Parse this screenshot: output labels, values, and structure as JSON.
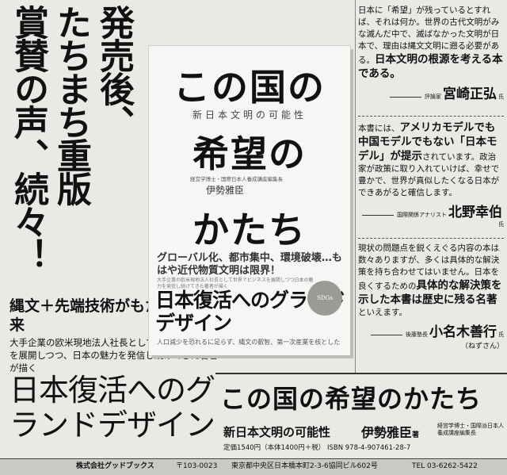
{
  "headline": {
    "line1": "発売後、",
    "line2": "たちまち重版",
    "line3": "賞賛の声、続々！"
  },
  "left": {
    "tagline": "縄文＋先端技術がもたらす未来",
    "description": "大手企業の欧米現地法人社長として世界でビジネスを展開しつつ、日本の魅力を発信し続けてきた著者が描く",
    "slogan": "日本復活へのグランドデザイン"
  },
  "book": {
    "title_a": "この国の",
    "subtitle": "新日本文明の可能性",
    "title_b": "希望の",
    "author_note": "経営学博士・国際日本人養成講座編集長",
    "author": "伊勢雅臣",
    "title_c": "かたち",
    "band_line": "グローバル化、都市集中、環境破壊…もはや近代物質文明は限界！",
    "band_small": "大手企業の欧米現地法人社長として世界でビジネスを展開しつつ日本の魅力を発信し続けてきた著者が描く",
    "band_big": "日本復活へのグランドデザイン",
    "band_bottom": "人口減少を恐れるに足らず、縄文の叡智、第一次産業を核とした",
    "seal": "SDGs"
  },
  "reviews": [
    {
      "text": "日本に「希望」が残っているとすれば、それは何か。世界の古代文明がみな滅んだ中で、滅ばなかった文明が日本で、理由は縄文文明に遡る必要がある。",
      "emph": "日本文明の根源を考える本である。",
      "title": "評論家",
      "name": "宮崎正弘",
      "suffix": "氏"
    },
    {
      "lead": "本書には、",
      "emph": "アメリカモデルでも中国モデルでもない「日本モデル」が提示",
      "text": "されています。政治家が政策に取り入れていけば、幸せで豊かで、世界が真似したくなる日本ができあがると確信します。",
      "title": "国際関係アナリスト",
      "name": "北野幸伯",
      "suffix": "氏"
    },
    {
      "text": "現状の問題点を鋭くえぐる内容の本は数々ありますが、多くは具体的な解決策を持ち合わせてはいません。日本を良くするための",
      "emph": "具体的な解決策を示した本書は歴史に残る名著",
      "tail": "といえます。",
      "title": "後藤塾長",
      "name": "小名木善行",
      "suffix": "氏",
      "nickname": "（ねずさん）"
    }
  ],
  "bottom": {
    "title": "この国の希望のかたち",
    "subtitle": "新日本文明の可能性",
    "author": "伊勢雅臣",
    "author_suffix": "著",
    "role": "経営学博士・国際派日本人養成講座編集長",
    "price": "定価1540円（本体1400円＋税） ISBN 978-4-907461-28-7"
  },
  "footer": {
    "publisher": "株式会社グッドブックス",
    "zip": "〒103-0023",
    "address": "東京都中央区日本橋本町2-3-6協同ビル602号",
    "tel": "TEL 03-6262-5422"
  }
}
